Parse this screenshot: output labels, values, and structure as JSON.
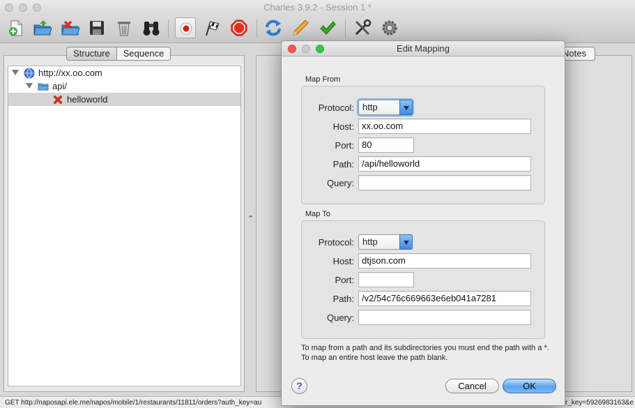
{
  "window": {
    "title": "Charles 3.9.2 - Session 1 *"
  },
  "toolbar": {
    "icons": [
      "new-session-icon",
      "open-session-icon",
      "close-session-icon",
      "save-icon",
      "trash-icon",
      "binoculars-icon",
      "record-icon",
      "throttle-flag-icon",
      "stop-breakpoints-icon",
      "repeat-icon",
      "edit-pencil-icon",
      "validate-check-icon",
      "tools-icon",
      "settings-gear-icon"
    ]
  },
  "sidebar": {
    "tabs": {
      "structure": "Structure",
      "sequence": "Sequence"
    },
    "tree": [
      {
        "label": "http://xx.oo.com",
        "icon": "globe-icon"
      },
      {
        "label": "api/",
        "icon": "folder-icon"
      },
      {
        "label": "helloworld",
        "icon": "red-x-icon"
      }
    ]
  },
  "right_panel": {
    "notes_tab": "Notes"
  },
  "status": {
    "left": "GET http://naposapi.ele.me/napos/mobile/1/restaurants/11811/orders?auth_key=au",
    "right": "r_key=5926983163&e"
  },
  "dialog": {
    "title": "Edit Mapping",
    "map_from": {
      "group_label": "Map From",
      "protocol_label": "Protocol:",
      "protocol_value": "http",
      "host_label": "Host:",
      "host_value": "xx.oo.com",
      "port_label": "Port:",
      "port_value": "80",
      "path_label": "Path:",
      "path_value": "/api/helloworld",
      "query_label": "Query:",
      "query_value": ""
    },
    "map_to": {
      "group_label": "Map To",
      "protocol_label": "Protocol:",
      "protocol_value": "http",
      "host_label": "Host:",
      "host_value": "dtjson.com",
      "port_label": "Port:",
      "port_value": "",
      "path_label": "Path:",
      "path_value": "/v2/54c76c669663e6eb041a7281",
      "query_label": "Query:",
      "query_value": ""
    },
    "help_text": "To map from a path and its subdirectories you must end the path with a *. To map an entire host leave the path blank.",
    "help_button": "?",
    "cancel_button": "Cancel",
    "ok_button": "OK"
  },
  "colors": {
    "accent_blue": "#5aa2ec",
    "close_red": "#fc5753",
    "minimize_yellow": "#fdbc40",
    "zoom_green": "#34c84a"
  }
}
